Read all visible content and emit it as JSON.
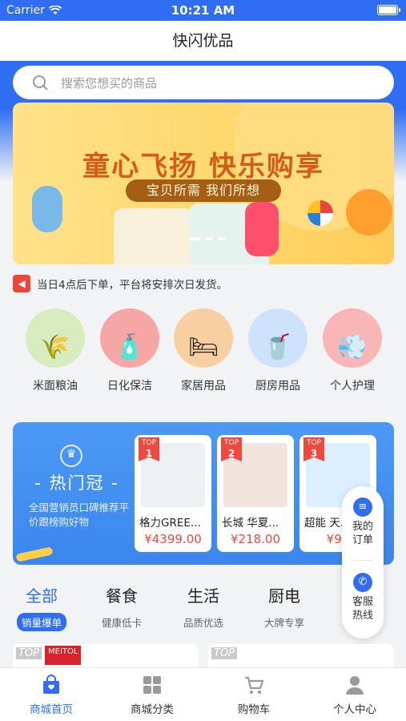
{
  "status_bar": {
    "carrier": "Carrier",
    "time": "10:21 AM"
  },
  "nav": {
    "title": "快闪优品"
  },
  "search": {
    "placeholder": "搜索您想买的商品"
  },
  "banner": {
    "headline": "童心飞扬 快乐购享",
    "ribbon": "宝贝所需 我们所想"
  },
  "notice": {
    "text": "当日4点后下单，平台将安排次日发货。"
  },
  "categories": [
    {
      "label": "米面粮油",
      "icon": "rice-bag-icon",
      "color": "#d9ecc0"
    },
    {
      "label": "日化保洁",
      "icon": "detergent-icon",
      "color": "#f7a6a6"
    },
    {
      "label": "家居用品",
      "icon": "bedding-icon",
      "color": "#f8cfa0"
    },
    {
      "label": "厨房用品",
      "icon": "blender-icon",
      "color": "#cfe2fb"
    },
    {
      "label": "个人护理",
      "icon": "hair-dryer-icon",
      "color": "#f9b6b6"
    }
  ],
  "hot": {
    "title": "热门冠",
    "description": "全国营销员口碑推荐平价跟榜购好物",
    "items": [
      {
        "top_label": "TOP",
        "rank": "1",
        "name": "格力GREE...",
        "price": "¥4399.00",
        "image_color": "#eef1f4"
      },
      {
        "top_label": "TOP",
        "rank": "2",
        "name": "长城 华夏...",
        "price": "¥218.00",
        "image_color": "#f1e4dc"
      },
      {
        "top_label": "TOP",
        "rank": "3",
        "name": "超能 天...",
        "price": "¥99",
        "image_color": "#dcefff"
      }
    ]
  },
  "floating": {
    "orders_label_1": "我的",
    "orders_label_2": "订单",
    "service_label_1": "客服",
    "service_label_2": "热线"
  },
  "tabs": [
    {
      "title": "全部",
      "subtitle": "销量爆单",
      "active": true
    },
    {
      "title": "餐食",
      "subtitle": "健康低卡",
      "active": false
    },
    {
      "title": "生活",
      "subtitle": "品质优选",
      "active": false
    },
    {
      "title": "厨电",
      "subtitle": "大牌专享",
      "active": false
    }
  ],
  "peek": {
    "left_tag": "TOP",
    "left_brand": "MEITOL",
    "right_tag": "TOP"
  },
  "tabbar": [
    {
      "label": "商城首页",
      "active": true
    },
    {
      "label": "商城分类",
      "active": false
    },
    {
      "label": "购物车",
      "active": false
    },
    {
      "label": "个人中心",
      "active": false
    }
  ],
  "colors": {
    "brand_blue": "#2f6ef3",
    "price_red": "#f0483c",
    "banner_text": "#d45c17"
  }
}
